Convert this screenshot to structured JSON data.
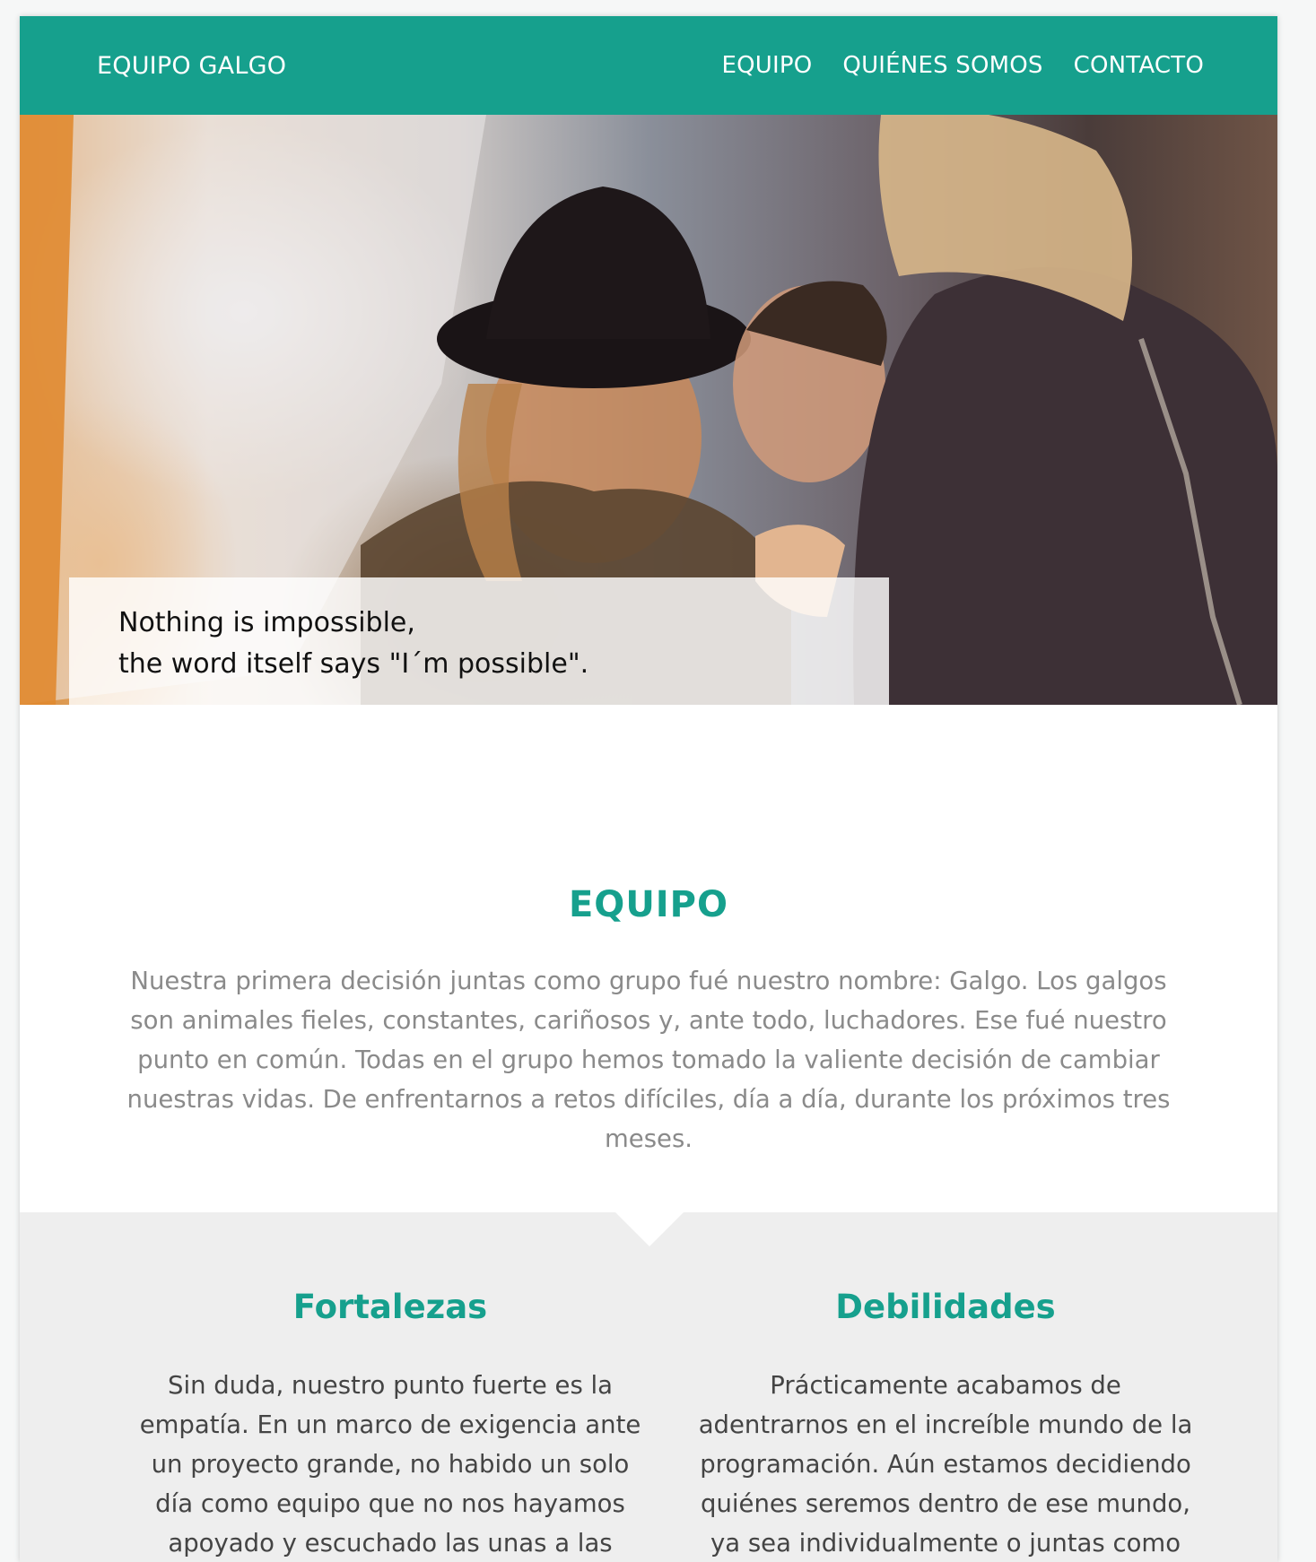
{
  "header": {
    "brand": "EQUIPO GALGO",
    "nav": [
      "EQUIPO",
      "QUIÉNES SOMOS",
      "CONTACTO"
    ]
  },
  "hero": {
    "image": "photo-of-three-smiling-women",
    "quote_line1": "Nothing is impossible,",
    "quote_line2": "the word itself says \"I´m possible\"."
  },
  "team": {
    "title": "EQUIPO",
    "text": "Nuestra primera decisión juntas como grupo fué nuestro nombre: Galgo. Los galgos son animales fieles, constantes, cariñosos y, ante todo, luchadores. Ese fué nuestro punto en común. Todas en el grupo hemos tomado la valiente decisión de cambiar nuestras vidas. De enfrentarnos a retos difíciles, día a día, durante los próximos tres meses."
  },
  "strengths": {
    "title": "Fortalezas",
    "text": "Sin duda, nuestro punto fuerte es la empatía. En un marco de exigencia ante un proyecto grande, no habido un solo día como equipo que no nos hayamos apoyado y escuchado las unas a las"
  },
  "weaknesses": {
    "title": "Debilidades",
    "text": "Prácticamente acabamos de adentrarnos en el increíble mundo de la programación. Aún estamos decidiendo quiénes seremos dentro de ese mundo, ya sea individualmente o juntas como"
  },
  "colors": {
    "accent": "#16a08d",
    "body_text": "#8a8a8a",
    "section_bg": "#eeeeee"
  }
}
